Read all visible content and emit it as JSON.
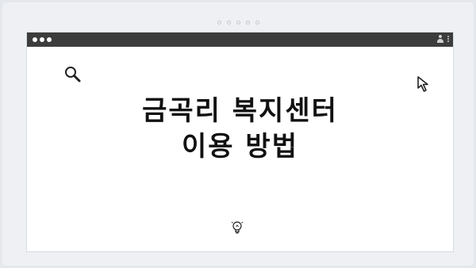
{
  "window": {
    "title_line_1": "금곡리 복지센터",
    "title_line_2": "이용 방법"
  },
  "icons": {
    "top_left": "search-icon",
    "top_right": "cursor-icon",
    "bottom": "lightbulb-icon",
    "titlebar_user": "user-icon",
    "titlebar_menu": "kebab-menu-icon"
  },
  "colors": {
    "titlebar": "#3c3c3c",
    "background": "#e4e7ec",
    "window": "#ffffff",
    "text": "#111111"
  }
}
